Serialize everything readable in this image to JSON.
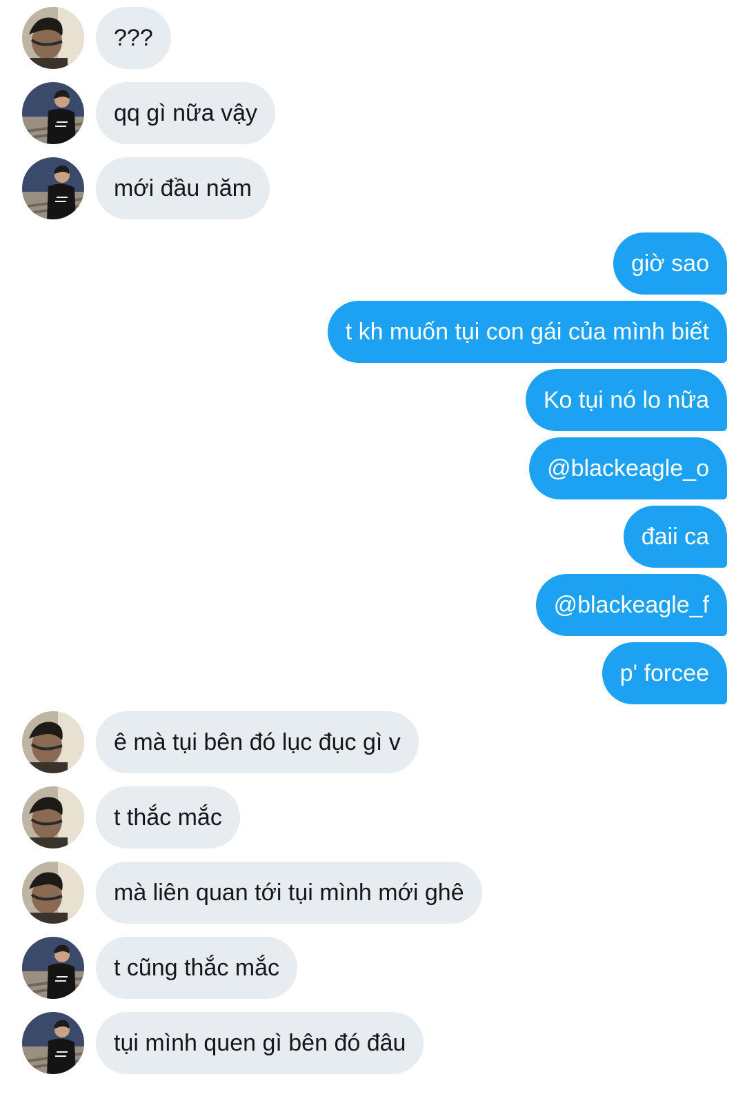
{
  "conversation": {
    "messages": [
      {
        "side": "incoming",
        "avatar": "avatar-headphones",
        "text": "???"
      },
      {
        "side": "incoming",
        "avatar": "avatar-stairs",
        "text": "qq gì nữa vậy"
      },
      {
        "side": "incoming",
        "avatar": "avatar-stairs",
        "text": "mới đầu năm"
      },
      {
        "side": "outgoing",
        "text": "giờ sao"
      },
      {
        "side": "outgoing",
        "text": "t kh muốn tụi con gái của mình biết"
      },
      {
        "side": "outgoing",
        "text": "Ko tụi nó lo nữa"
      },
      {
        "side": "outgoing",
        "text": "@blackeagle_o"
      },
      {
        "side": "outgoing",
        "text": "đaii ca"
      },
      {
        "side": "outgoing",
        "text": "@blackeagle_f"
      },
      {
        "side": "outgoing",
        "text": "p' forcee"
      },
      {
        "side": "incoming",
        "avatar": "avatar-headphones",
        "text": "ê mà tụi bên đó lục đục gì v"
      },
      {
        "side": "incoming",
        "avatar": "avatar-headphones",
        "text": "t thắc mắc"
      },
      {
        "side": "incoming",
        "avatar": "avatar-headphones",
        "text": "mà liên quan tới tụi mình mới ghê"
      },
      {
        "side": "incoming",
        "avatar": "avatar-stairs",
        "text": "t cũng thắc mắc"
      },
      {
        "side": "incoming",
        "avatar": "avatar-stairs",
        "text": "tụi mình quen gì bên đó đâu"
      }
    ]
  },
  "colors": {
    "incoming_bubble": "#e6ecf0",
    "incoming_text": "#14171a",
    "outgoing_bubble": "#1da1f2",
    "outgoing_text": "#ffffff"
  }
}
